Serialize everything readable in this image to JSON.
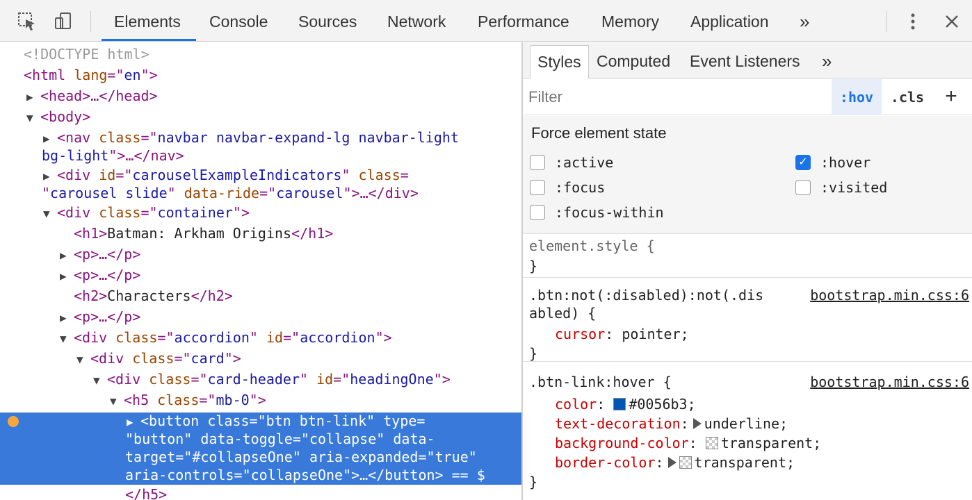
{
  "toolbar": {
    "tabs": [
      "Elements",
      "Console",
      "Sources",
      "Network",
      "Performance",
      "Memory",
      "Application"
    ],
    "more": "»"
  },
  "dom": {
    "doctype": "<!DOCTYPE html>",
    "l1_open": "<html ",
    "l1_attr": "lang",
    "l1_eq": "=\"",
    "l1_val": "en",
    "l1_close": "\">",
    "head": "<head>…</head>",
    "body": "<body>",
    "nav_open": "<nav ",
    "nav_attr": "class",
    "nav_val1": "navbar navbar-expand-lg navbar-light",
    "nav_val2": "bg-light",
    "nav_close": "\">…</nav>",
    "div_open": "<div ",
    "id_attr": "id",
    "carousel_id": "carouselExampleIndicators",
    "class_attr": "class",
    "carousel_class": "carousel slide",
    "data_ride_attr": "data-ride",
    "data_ride_val": "carousel",
    "div_close": "\">…</div>",
    "container_val": "container",
    "h1_open": "<h1>",
    "h1_text": "Batman: Arkham Origins",
    "h1_close": "</h1>",
    "p_collapsed": "<p>…</p>",
    "h2_open": "<h2>",
    "h2_text": "Characters",
    "h2_close": "</h2>",
    "accordion_val": "accordion",
    "card_val": "card",
    "card_header_val": "card-header",
    "heading_id": "headingOne",
    "h5_open": "<h5 ",
    "mb_val": "mb-0",
    "button_open": "<button ",
    "btn_class": "btn btn-link",
    "type_attr": "type",
    "type_val": "button",
    "toggle_attr": "data-toggle",
    "toggle_val": "collapse",
    "target_attr1": "data-",
    "target_attr2": "target",
    "target_val": "#collapseOne",
    "expanded_attr": "aria-expanded",
    "expanded_val": "true",
    "controls_attr": "aria-controls",
    "controls_val": "collapseOne",
    "button_close": "\">…</button>",
    "dollar": " == $",
    "h5_close": "</h5>"
  },
  "styles": {
    "tabs": [
      "Styles",
      "Computed",
      "Event Listeners"
    ],
    "more": "»",
    "filter_placeholder": "Filter",
    "hov": ":hov",
    "cls": ".cls",
    "plus": "+",
    "force_title": "Force element state",
    "states": [
      {
        "label": ":active",
        "checked": false
      },
      {
        "label": ":hover",
        "checked": true
      },
      {
        "label": ":focus",
        "checked": false
      },
      {
        "label": ":visited",
        "checked": false
      },
      {
        "label": ":focus-within",
        "checked": false
      }
    ],
    "rules": {
      "element_style": "element.style {",
      "close": "}",
      "btn_selector1": ".btn:not(:disabled):not(.dis",
      "btn_selector2": "abled) {",
      "btn_source": "bootstrap.min.css:6",
      "cursor_prop": "cursor",
      "cursor_val": " pointer;",
      "hover_selector": ".btn-link:hover {",
      "hover_source": "bootstrap.min.css:6",
      "color_prop": "color",
      "color_val": "#0056b3;",
      "color_swatch": "#0056b3",
      "td_prop": "text-decoration",
      "td_val": "underline;",
      "bg_prop": "background-color",
      "bg_val": "transparent;",
      "border_prop": "border-color",
      "border_val": "transparent;"
    }
  },
  "colors": {
    "accent": "#1a73e8",
    "selection": "#3879d9",
    "breakpoint_dot": "#f4a73d"
  }
}
